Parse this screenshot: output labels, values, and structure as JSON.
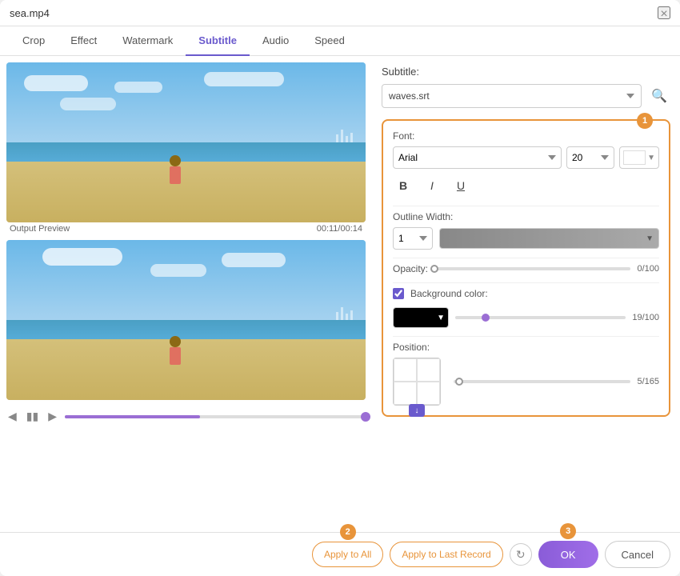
{
  "window": {
    "title": "sea.mp4",
    "close_label": "×"
  },
  "tabs": [
    {
      "id": "crop",
      "label": "Crop",
      "active": false
    },
    {
      "id": "effect",
      "label": "Effect",
      "active": false
    },
    {
      "id": "watermark",
      "label": "Watermark",
      "active": false
    },
    {
      "id": "subtitle",
      "label": "Subtitle",
      "active": true
    },
    {
      "id": "audio",
      "label": "Audio",
      "active": false
    },
    {
      "id": "speed",
      "label": "Speed",
      "active": false
    }
  ],
  "preview": {
    "label": "Output Preview",
    "timecode": "00:11/00:14"
  },
  "subtitle": {
    "header": "Subtitle:",
    "file": "waves.srt",
    "search_placeholder": "Search subtitle file"
  },
  "font": {
    "label": "Font:",
    "family": "Arial",
    "size": "20",
    "color": "#ffffff"
  },
  "style_buttons": {
    "bold": "B",
    "italic": "I",
    "underline": "U"
  },
  "outline": {
    "label": "Outline Width:",
    "width": "1"
  },
  "opacity": {
    "label": "Opacity:",
    "value": "0/100"
  },
  "background": {
    "label": "Background color:",
    "enabled": true,
    "color": "#000000",
    "value": "19/100"
  },
  "position": {
    "label": "Position:",
    "value": "5/165"
  },
  "badges": {
    "b1": "1",
    "b2": "2",
    "b3": "3"
  },
  "buttons": {
    "apply_all": "Apply to All",
    "apply_last": "Apply to Last Record",
    "ok": "OK",
    "cancel": "Cancel"
  }
}
